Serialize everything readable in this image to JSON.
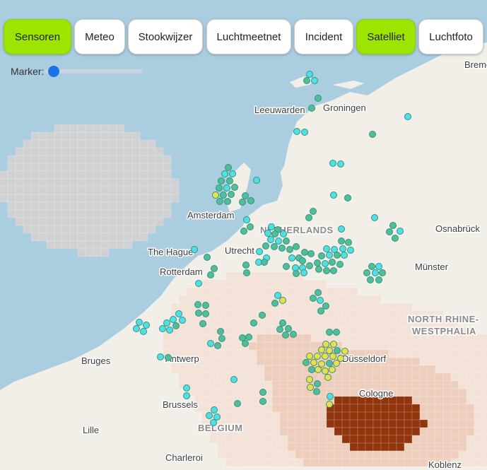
{
  "tabs": [
    {
      "label": "Sensoren",
      "active": true
    },
    {
      "label": "Meteo",
      "active": false
    },
    {
      "label": "Stookwijzer",
      "active": false
    },
    {
      "label": "Luchtmeetnet",
      "active": false
    },
    {
      "label": "Incident",
      "active": false
    },
    {
      "label": "Satelliet",
      "active": true
    },
    {
      "label": "Luchtfoto",
      "active": false
    }
  ],
  "marker_control": {
    "label": "Marker:",
    "value": 0
  },
  "map": {
    "cities": [
      "Bremen",
      "Leeuwarden",
      "Groningen",
      "Amsterdam",
      "NETHERLANDS",
      "Osnabrück",
      "The Hague",
      "Utrecht",
      "Rotterdam",
      "Münster",
      "NORTH RHINE-",
      "WESTPHALIA",
      "Bruges",
      "Antwerp",
      "Düsseldorf",
      "Brussels",
      "BELGIUM",
      "Cologne",
      "Lille",
      "Charleroi",
      "Koblenz"
    ],
    "sensor_colors": {
      "teal": "#4dbf9c",
      "cyan": "#4ee0e8",
      "yellow": "#e8e04a"
    },
    "overlay_colors": {
      "low": "#f4d5c5",
      "mid": "#e6a383",
      "high": "#8b2a00"
    }
  }
}
